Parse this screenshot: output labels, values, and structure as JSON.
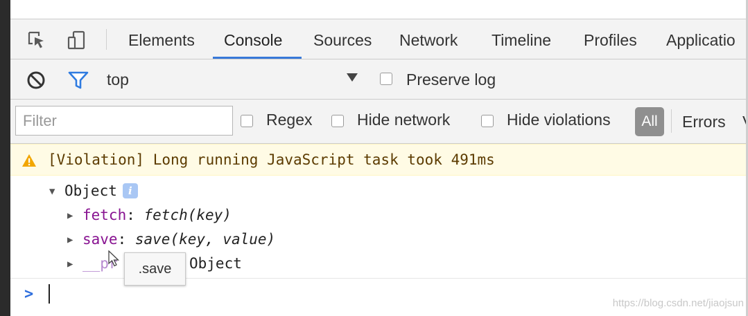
{
  "tabs": [
    {
      "label": "Elements"
    },
    {
      "label": "Console"
    },
    {
      "label": "Sources"
    },
    {
      "label": "Network"
    },
    {
      "label": "Timeline"
    },
    {
      "label": "Profiles"
    },
    {
      "label": "Applicatio"
    }
  ],
  "toolbar": {
    "context": "top",
    "preserve_log": "Preserve log"
  },
  "filter": {
    "placeholder": "Filter",
    "regex": "Regex",
    "hide_network": "Hide network",
    "hide_violations": "Hide violations",
    "all": "All",
    "errors": "Errors",
    "next_level_partial": "V"
  },
  "console": {
    "violation": "[Violation] Long running JavaScript task took 491ms",
    "object_label": "Object",
    "info_badge": "i",
    "fetch_key": "fetch",
    "fetch_sep": ": ",
    "fetch_val": "fetch(key)",
    "save_key": "save",
    "save_sep": ": ",
    "save_val": "save(key, value)",
    "proto_key": "__pr",
    "proto_val": "Object",
    "tooltip": ".save",
    "prompt": ">"
  },
  "watermark": "https://blog.csdn.net/jiaojsun",
  "colors": {
    "accent": "#3879d9",
    "violation_bg": "#fffbe5",
    "warning": "#f2a600",
    "property": "#881391"
  }
}
